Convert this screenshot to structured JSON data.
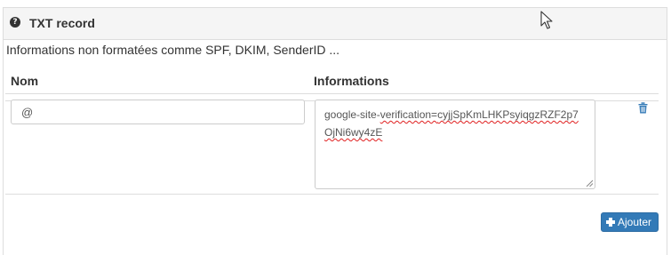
{
  "panel": {
    "title": "TXT record",
    "header_icon": "question-circle-icon",
    "cursor_icon": "mouse-pointer-icon"
  },
  "description": "Informations non formatées comme SPF, DKIM, SenderID ...",
  "table": {
    "columns": [
      "Nom",
      "Informations"
    ],
    "rows": [
      {
        "nom": "@",
        "info_prefix": "google-site-",
        "info_plain": "verification=",
        "info_misspelled": "cyjjSpKmLHKPsyiqgzRZF2p7OjNi6wy4zE",
        "delete_icon": "trash-icon"
      }
    ]
  },
  "add_button": {
    "label": "Ajouter",
    "icon": "plus-icon"
  },
  "colors": {
    "primary_button": "#337ab7",
    "link_icon": "#337ab7",
    "panel_heading_bg": "#f5f5f5",
    "border": "#dddddd",
    "spellcheck_underline": "#e02020"
  }
}
